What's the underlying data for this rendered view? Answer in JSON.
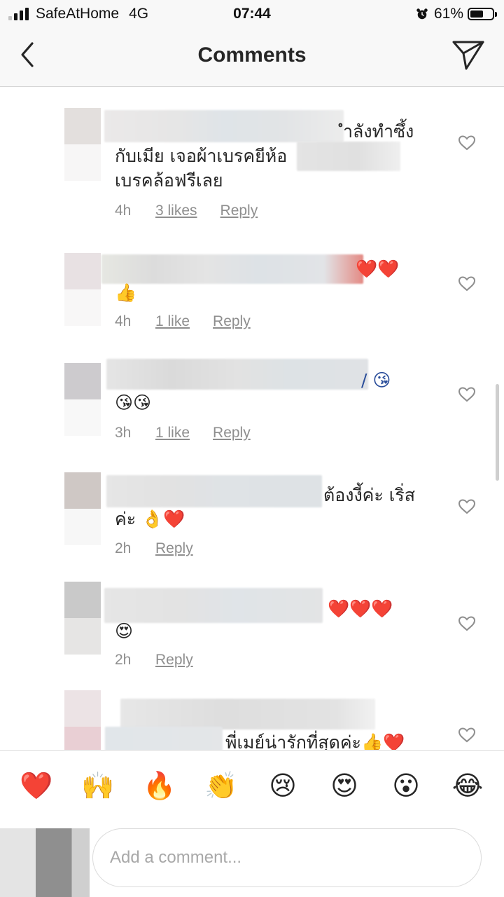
{
  "status_bar": {
    "carrier": "SafeAtHome",
    "network": "4G",
    "time": "07:44",
    "battery": "61%",
    "battery_level": 0.61
  },
  "header": {
    "title": "Comments",
    "back_icon": "chevron-left-icon",
    "share_icon": "paper-plane-icon"
  },
  "comments": [
    {
      "line1": "ำลังทำซึ้ง",
      "line2": "กับเมีย เจอผ้าเบรคยีห้อ",
      "line3": "เบรคล้อฟรีเลย",
      "time": "4h",
      "likes": "3 likes",
      "reply": "Reply"
    },
    {
      "line1": "❤️❤️",
      "line2": "👍",
      "time": "4h",
      "likes": "1 like",
      "reply": "Reply"
    },
    {
      "line1": "/ 😘",
      "line2": "😘😘",
      "time": "3h",
      "likes": "1 like",
      "reply": "Reply"
    },
    {
      "line1": "ต้องงี้ค่ะ เริ่ส",
      "line2": "ค่ะ 👌❤️",
      "time": "2h",
      "reply": "Reply"
    },
    {
      "line1": "❤️❤️❤️",
      "line2": "😍",
      "time": "2h",
      "reply": "Reply"
    },
    {
      "line1": "พี่เมย์น่ารักที่สุดค่ะ👍❤️"
    }
  ],
  "quick_reactions": [
    "❤️",
    "🙌",
    "🔥",
    "👏",
    "😢",
    "😍",
    "😮",
    "😂"
  ],
  "input": {
    "placeholder": "Add a comment..."
  },
  "colors": {
    "text": "#262626",
    "meta": "#8e8e8e",
    "bar_bg": "#f8f8f8",
    "divider": "#dbdbdb"
  }
}
